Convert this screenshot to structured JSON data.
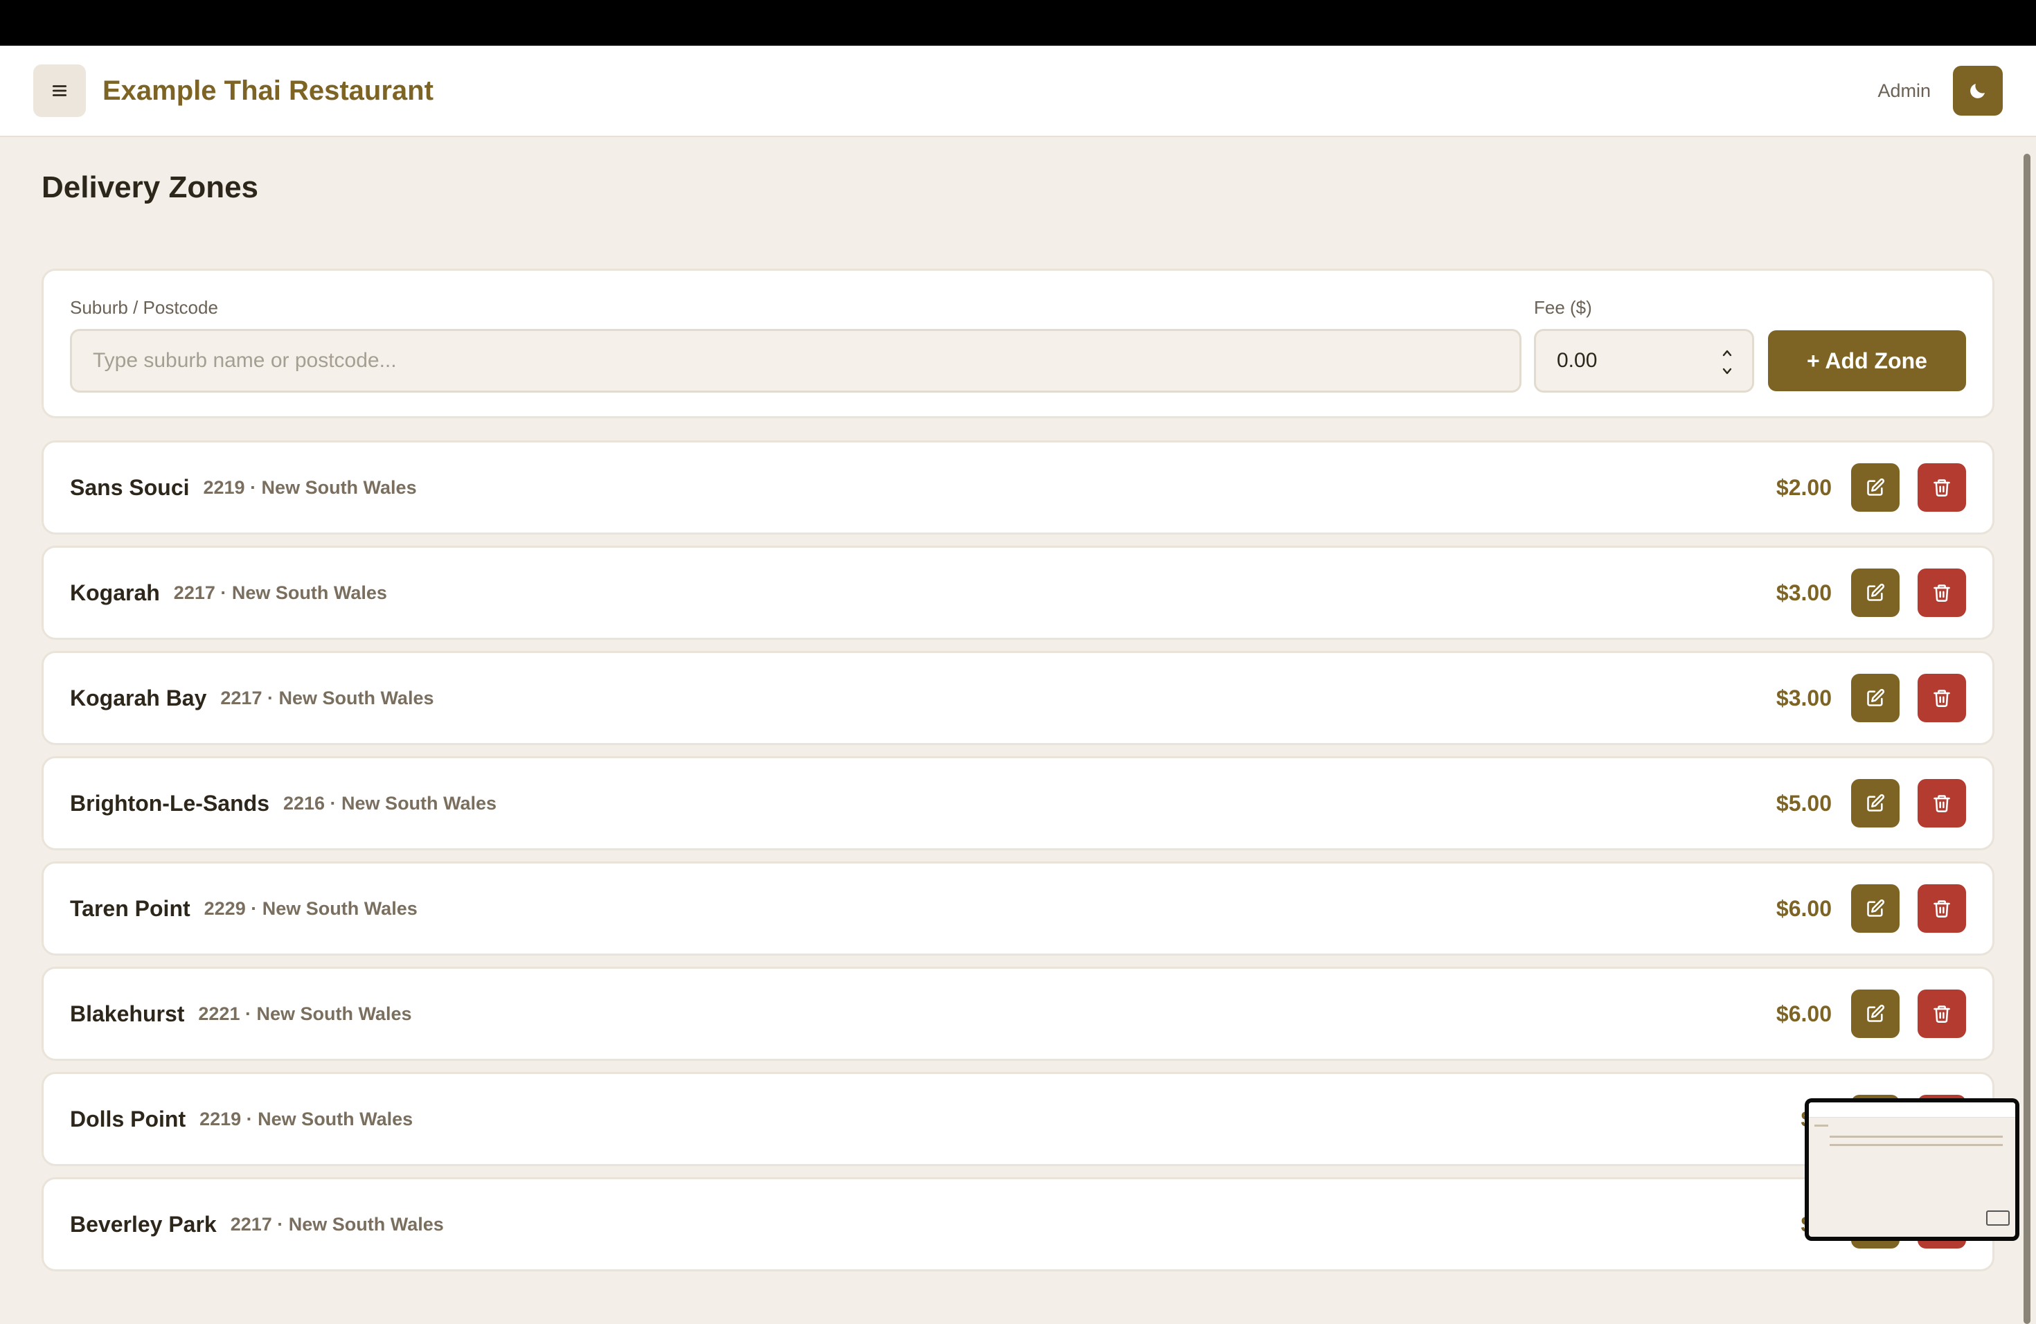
{
  "header": {
    "app_title": "Example Thai Restaurant",
    "user_label": "Admin",
    "menu_icon": "hamburger-icon",
    "theme_icon": "moon-icon"
  },
  "page": {
    "title": "Delivery Zones"
  },
  "add_form": {
    "suburb_label": "Suburb / Postcode",
    "suburb_placeholder": "Type suburb name or postcode...",
    "suburb_value": "",
    "fee_label": "Fee ($)",
    "fee_value": "0.00",
    "add_button_label": "+ Add Zone"
  },
  "zones": [
    {
      "name": "Sans Souci",
      "meta": "2219 · New South Wales",
      "fee": "$2.00"
    },
    {
      "name": "Kogarah",
      "meta": "2217 · New South Wales",
      "fee": "$3.00"
    },
    {
      "name": "Kogarah Bay",
      "meta": "2217 · New South Wales",
      "fee": "$3.00"
    },
    {
      "name": "Brighton-Le-Sands",
      "meta": "2216 · New South Wales",
      "fee": "$5.00"
    },
    {
      "name": "Taren Point",
      "meta": "2229 · New South Wales",
      "fee": "$6.00"
    },
    {
      "name": "Blakehurst",
      "meta": "2221 · New South Wales",
      "fee": "$6.00"
    },
    {
      "name": "Dolls Point",
      "meta": "2219 · New South Wales",
      "fee": "$2."
    },
    {
      "name": "Beverley Park",
      "meta": "2217 · New South Wales",
      "fee": "$2."
    }
  ],
  "colors": {
    "accent": "#7d6424",
    "danger": "#b33b30",
    "background": "#f3efe8"
  }
}
